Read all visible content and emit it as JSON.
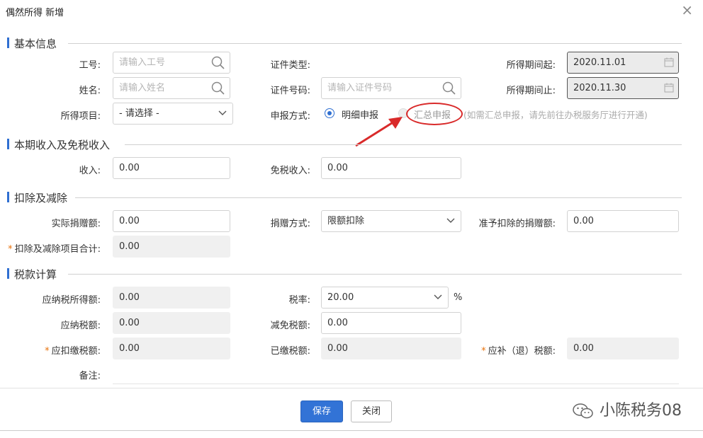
{
  "dialog": {
    "title": "偶然所得 新增",
    "close_glyph": "×"
  },
  "sections": {
    "basic": "基本信息",
    "income": "本期收入及免税收入",
    "deduction": "扣除及减除",
    "tax": "税款计算"
  },
  "basic": {
    "emp_id_label": "工号:",
    "emp_id_placeholder": "请输入工号",
    "name_label": "姓名:",
    "name_placeholder": "请输入姓名",
    "income_item_label": "所得项目:",
    "income_item_value": "- 请选择 -",
    "id_type_label": "证件类型:",
    "id_no_label": "证件号码:",
    "id_no_placeholder": "请输入证件号码",
    "declare_label": "申报方式:",
    "declare_option1": "明细申报",
    "declare_option2": "汇总申报",
    "declare_hint": "(如需汇总申报，请先前往办税服务厅进行开通)",
    "period_start_label": "所得期间起:",
    "period_start_value": "2020.11.01",
    "period_end_label": "所得期间止:",
    "period_end_value": "2020.11.30"
  },
  "income": {
    "income_label": "收入:",
    "income_value": "0.00",
    "exempt_label": "免税收入:",
    "exempt_value": "0.00"
  },
  "deduction": {
    "donation_label": "实际捐赠额:",
    "donation_value": "0.00",
    "donation_method_label": "捐赠方式:",
    "donation_method_value": "限额扣除",
    "allowed_donation_label": "准予扣除的捐赠额:",
    "allowed_donation_value": "0.00",
    "total_label": "扣除及减除项目合计:",
    "total_value": "0.00"
  },
  "tax": {
    "taxable_income_label": "应纳税所得额:",
    "taxable_income_value": "0.00",
    "rate_label": "税率:",
    "rate_value": "20.00",
    "rate_unit": "%",
    "tax_payable_label": "应纳税额:",
    "tax_payable_value": "0.00",
    "reduction_label": "减免税额:",
    "reduction_value": "0.00",
    "withholding_label": "应扣缴税额:",
    "withholding_value": "0.00",
    "paid_label": "已缴税额:",
    "paid_value": "0.00",
    "refund_label": "应补（退）税额:",
    "refund_value": "0.00",
    "remark_label": "备注:"
  },
  "footer": {
    "save": "保存",
    "close": "关闭"
  },
  "watermark": "小陈税务08",
  "colors": {
    "accent": "#2f6fd1",
    "annotation": "#d92a2a",
    "required": "#e8720c"
  },
  "icons": [
    "search-icon",
    "calendar-icon",
    "chevron-down-icon",
    "close-icon",
    "annotation-arrow",
    "wechat-icon"
  ]
}
